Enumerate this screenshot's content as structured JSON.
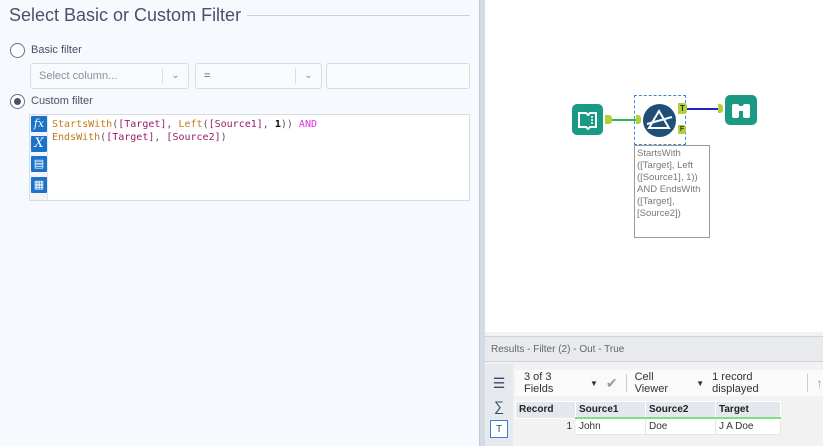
{
  "config": {
    "title": "Select Basic or Custom Filter",
    "basic_filter_label": "Basic filter",
    "column_placeholder": "Select column...",
    "operator_value": "=",
    "value_input": "",
    "custom_filter_label": "Custom filter",
    "editor_buttons": {
      "fx": "fx",
      "x": "X"
    },
    "expression": {
      "line1": [
        [
          "fn",
          "StartsWith"
        ],
        [
          "pn",
          "("
        ],
        [
          "fld",
          "[Target]"
        ],
        [
          "pn",
          ", "
        ],
        [
          "fn",
          "Left"
        ],
        [
          "pn",
          "("
        ],
        [
          "fld",
          "[Source1]"
        ],
        [
          "pn",
          ", "
        ],
        [
          "num",
          "1"
        ],
        [
          "pn",
          "))"
        ],
        [
          "kw",
          " AND"
        ]
      ],
      "line2": [
        [
          "fn",
          "EndsWith"
        ],
        [
          "pn",
          "("
        ],
        [
          "fld",
          "[Target]"
        ],
        [
          "pn",
          ", "
        ],
        [
          "fld",
          "[Source2]"
        ],
        [
          "pn",
          ")"
        ]
      ]
    }
  },
  "canvas": {
    "annotation": "StartsWith ([Target], Left ([Source1], 1)) AND EndsWith ([Target], [Source2])",
    "true_anchor": "T",
    "false_anchor": "F"
  },
  "results": {
    "header": "Results - Filter (2) - Out - True",
    "fields": "3 of 3 Fields",
    "viewer": "Cell Viewer",
    "records": "1 record displayed",
    "columns": [
      "Record",
      "Source1",
      "Source2",
      "Target"
    ],
    "rows": [
      [
        "1",
        "John",
        "Doe",
        "J A Doe"
      ]
    ]
  },
  "colors": {
    "accent": "#1a73c8",
    "tool": "#1a9a85",
    "filter": "#1f4e79"
  }
}
